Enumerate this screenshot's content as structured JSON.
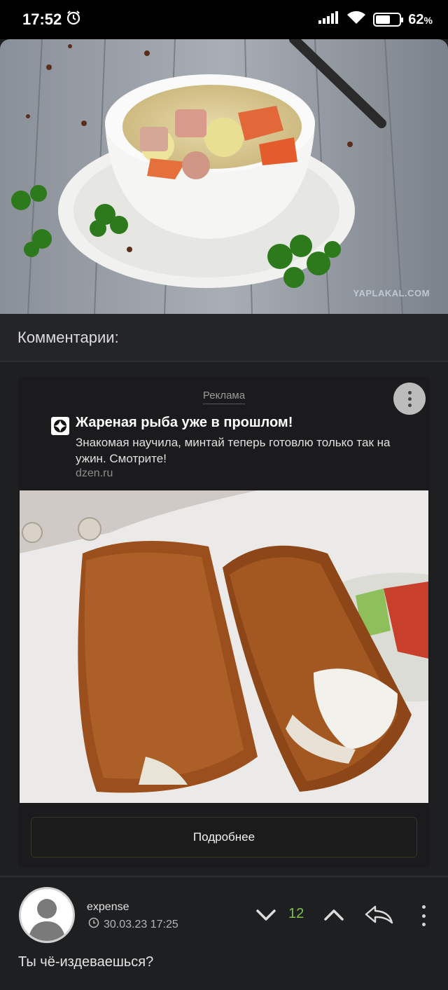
{
  "status_bar": {
    "time": "17:52",
    "battery_percent": "62",
    "battery_level": 0.62,
    "pct_sign": "%",
    "icons": [
      "alarm-icon",
      "signal-icon",
      "wifi-icon",
      "battery-icon"
    ]
  },
  "hero": {
    "watermark": "YAPLAKAL.COM"
  },
  "comments": {
    "header": "Комментарии:"
  },
  "ad": {
    "label": "Реклама",
    "title": "Жареная рыба уже в прошлом!",
    "description": "Знакомая научила, минтай теперь готовлю только так на ужин. Смотрите!",
    "domain": "dzen.ru",
    "button_label": "Подробнее"
  },
  "comment": {
    "username": "expense",
    "date": "30.03.23 17:25",
    "rating": "12",
    "text": "Ты чё-издеваешься?",
    "rating_color": "#7fbf4c"
  }
}
